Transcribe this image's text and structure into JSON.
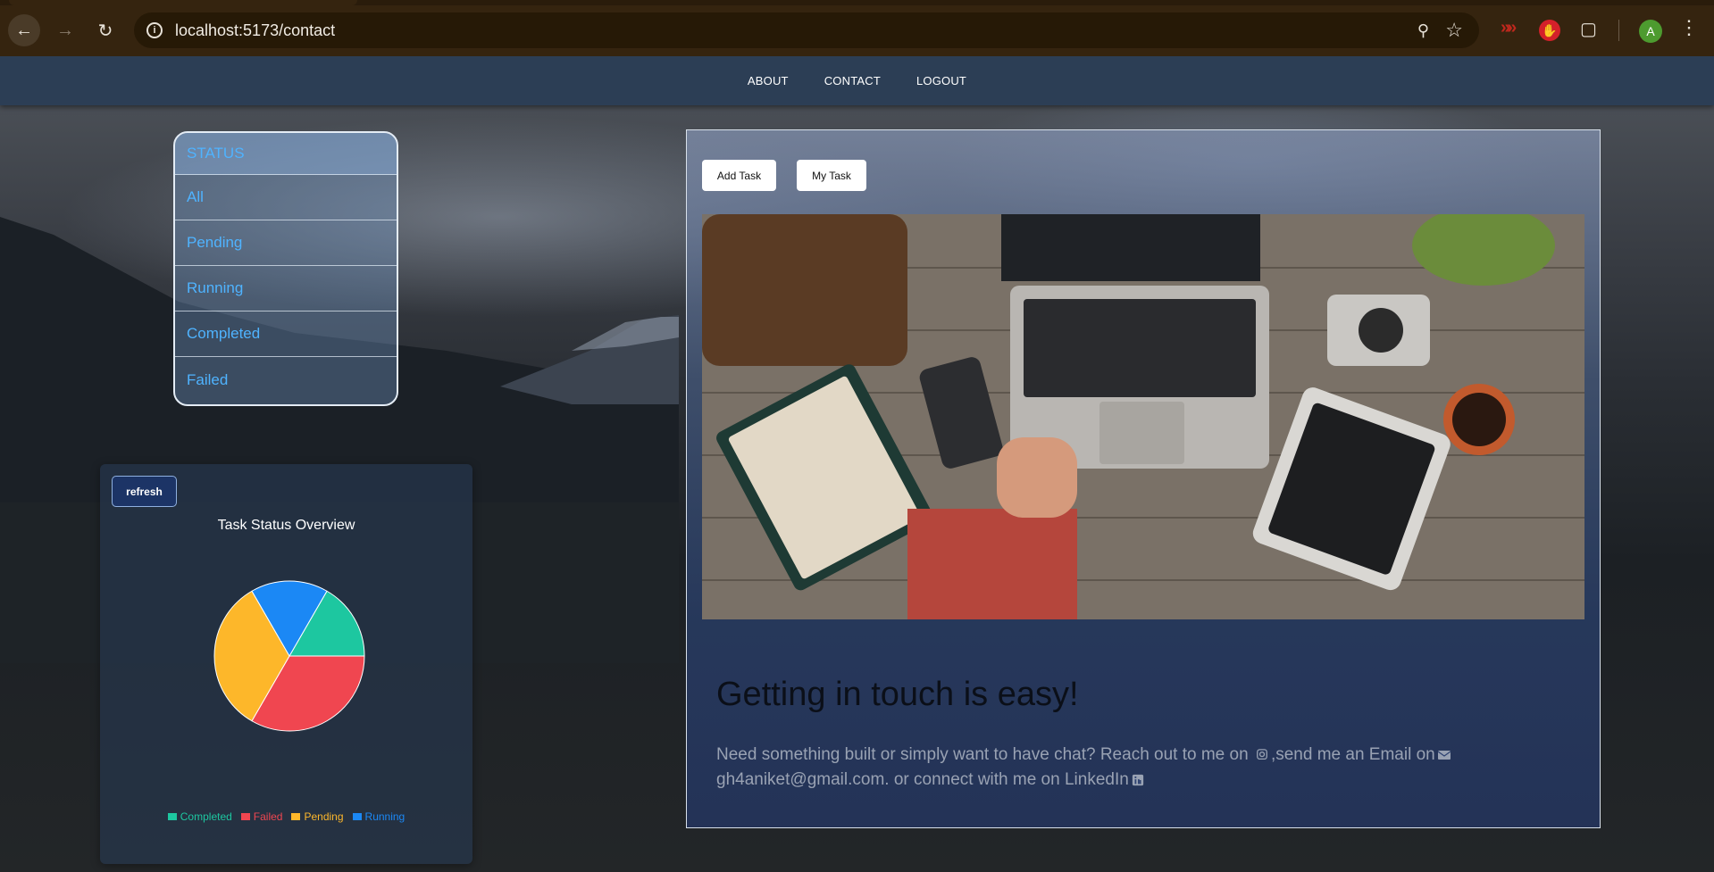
{
  "browser": {
    "url": "localhost:5173/contact",
    "profile_initial": "A",
    "icons": {
      "back": "back-arrow-icon",
      "forward": "forward-arrow-icon",
      "reload": "reload-icon",
      "site_info": "info-icon",
      "zoom": "zoom-out-icon",
      "bookmark": "star-icon",
      "extension_1": "double-arrow-extension-icon",
      "extension_2": "hand-extension-icon",
      "extensions": "puzzle-icon",
      "menu": "kebab-menu-icon"
    }
  },
  "navbar": {
    "links": [
      "ABOUT",
      "CONTACT",
      "LOGOUT"
    ]
  },
  "status_list": {
    "header": "STATUS",
    "items": [
      "All",
      "Pending",
      "Running",
      "Completed",
      "Failed"
    ]
  },
  "chart_card": {
    "refresh_label": "refresh",
    "title": "Task Status Overview"
  },
  "chart_data": {
    "type": "pie",
    "title": "Task Status Overview",
    "legend_position": "bottom",
    "slices": [
      {
        "label": "Completed",
        "value": 1,
        "color": "#1dc7a0"
      },
      {
        "label": "Failed",
        "value": 2,
        "color": "#f04650"
      },
      {
        "label": "Pending",
        "value": 2,
        "color": "#fdb72a"
      },
      {
        "label": "Running",
        "value": 1,
        "color": "#1b88f5"
      }
    ]
  },
  "content": {
    "add_task_label": "Add Task",
    "my_task_label": "My Task",
    "heading": "Getting in touch is easy!",
    "text_part1": "Need something built or simply want to have chat? Reach out to me on ",
    "text_part2": ",send me an Email on",
    "text_part3": " gh4aniket@gmail.com. or connect with me on LinkedIn"
  },
  "colors": {
    "navbar": "#2c3e55",
    "status_text": "#4fb3ff",
    "refresh_button": "#1c3466"
  }
}
